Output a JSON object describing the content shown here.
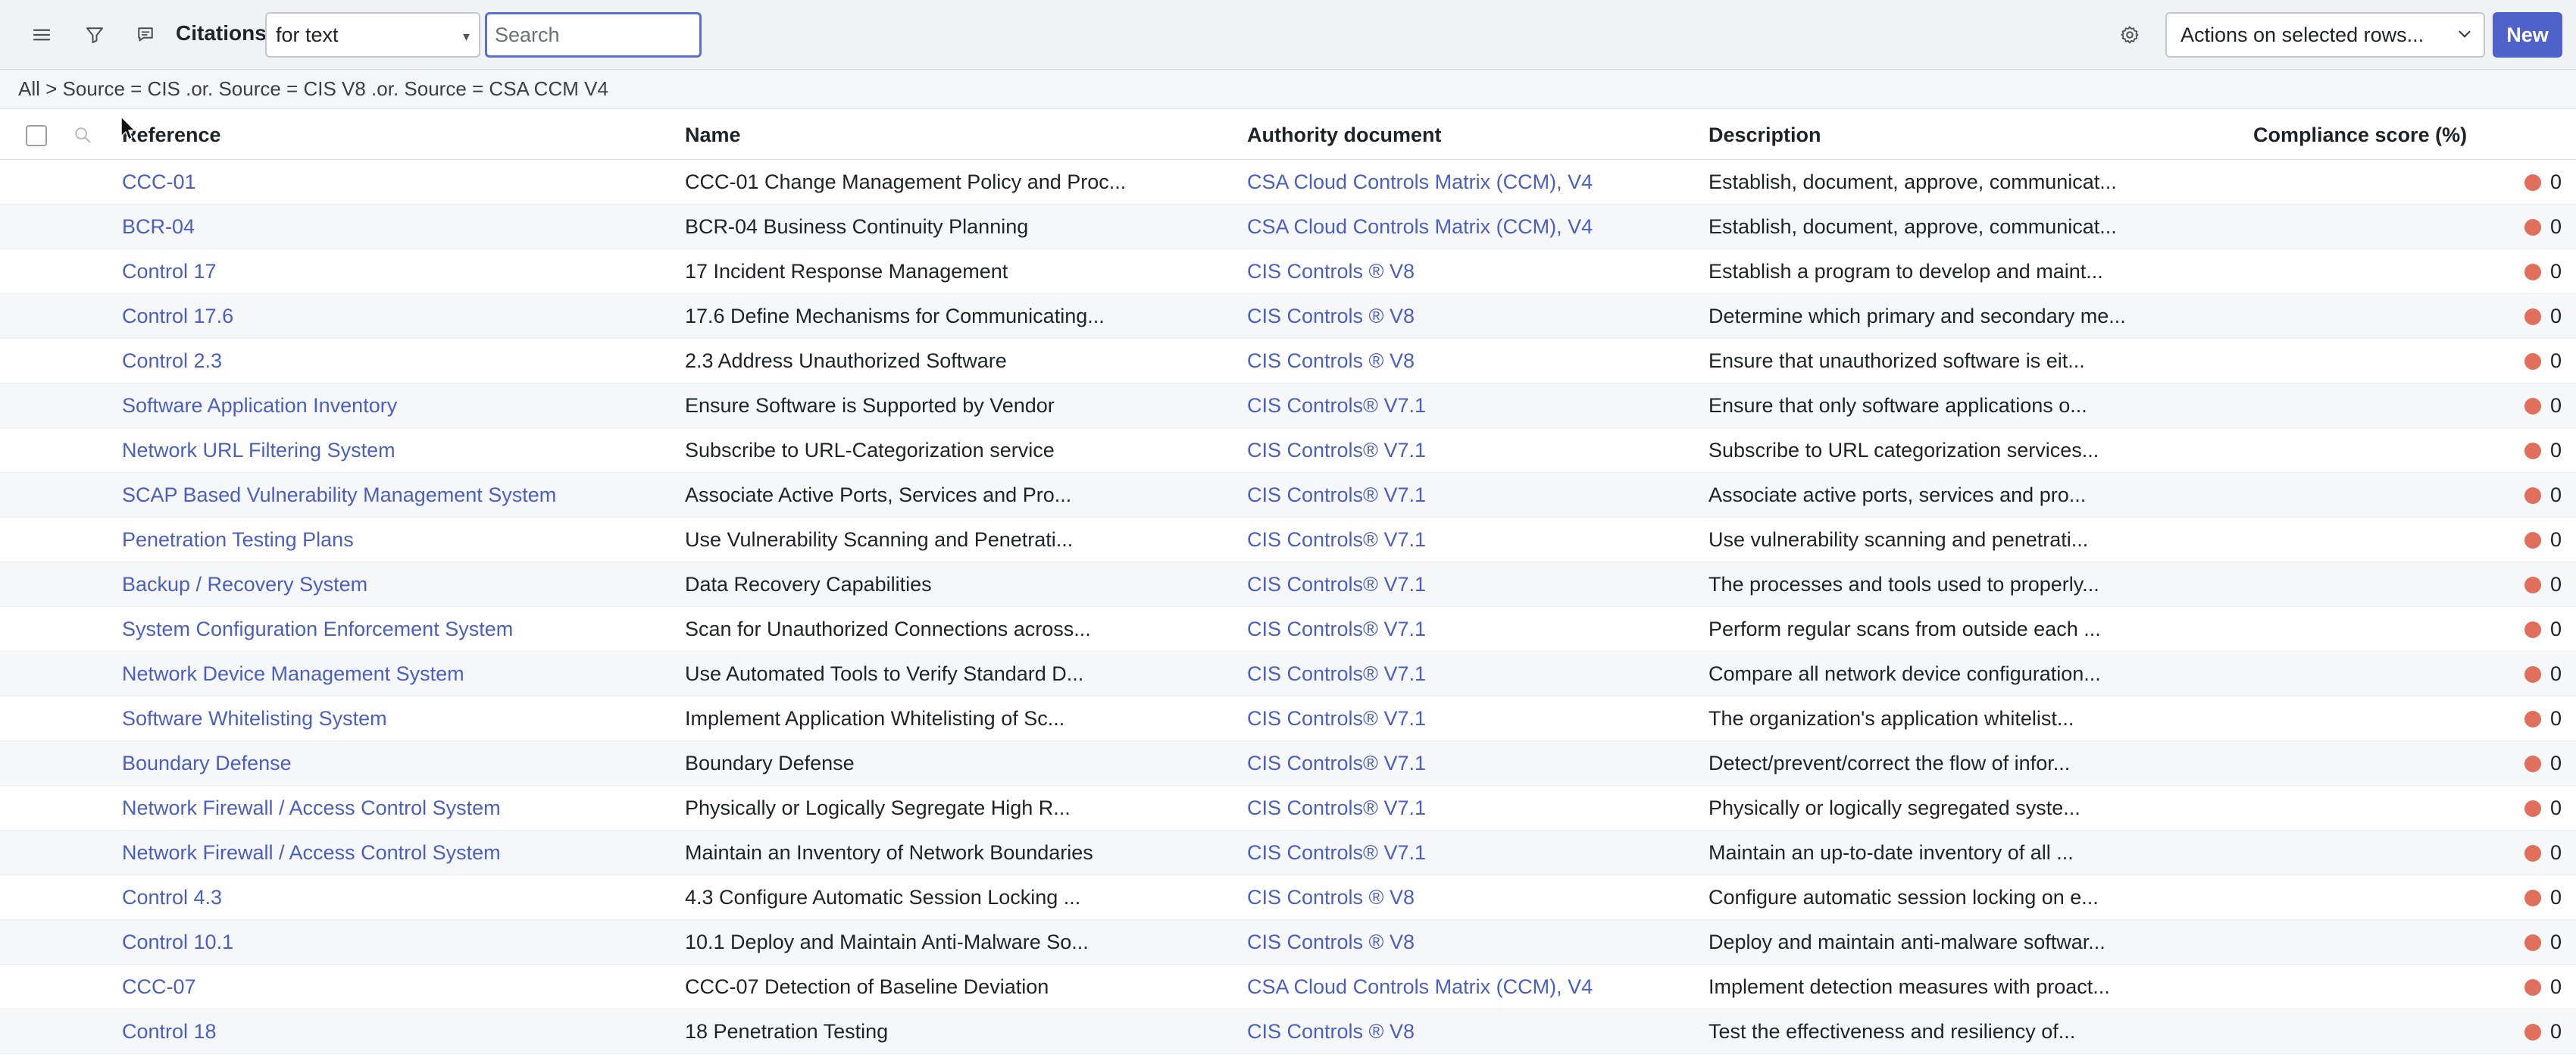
{
  "header": {
    "title": "Citations",
    "search_type": "for text",
    "search_placeholder": "Search",
    "actions_label": "Actions on selected rows...",
    "new_label": "New",
    "accent_color": "#4f62c9"
  },
  "breadcrumb": "All > Source = CIS .or. Source = CIS V8 .or. Source = CSA CCM V4",
  "columns": {
    "reference": "Reference",
    "name": "Name",
    "authority": "Authority document",
    "description": "Description",
    "score": "Compliance score (%)"
  },
  "rows": [
    {
      "ref": "CCC-01",
      "name": "CCC-01 Change Management Policy and Proc...",
      "authority": "CSA Cloud Controls Matrix (CCM), V4",
      "description": "Establish, document, approve, communicat...",
      "score": "0"
    },
    {
      "ref": "BCR-04",
      "name": "BCR-04 Business Continuity Planning",
      "authority": "CSA Cloud Controls Matrix (CCM), V4",
      "description": "Establish, document, approve, communicat...",
      "score": "0"
    },
    {
      "ref": "Control 17",
      "name": "17 Incident Response Management",
      "authority": "CIS Controls ® V8",
      "description": "Establish a program to develop and maint...",
      "score": "0"
    },
    {
      "ref": "Control 17.6",
      "name": "17.6 Define Mechanisms for Communicating...",
      "authority": "CIS Controls ® V8",
      "description": "Determine which primary and secondary me...",
      "score": "0"
    },
    {
      "ref": "Control 2.3",
      "name": "2.3 Address Unauthorized Software",
      "authority": "CIS Controls ® V8",
      "description": "Ensure that unauthorized software is eit...",
      "score": "0"
    },
    {
      "ref": "Software Application Inventory",
      "name": "Ensure Software is Supported by Vendor",
      "authority": "CIS Controls® V7.1",
      "description": "Ensure that only software applications o...",
      "score": "0"
    },
    {
      "ref": "Network URL Filtering System",
      "name": "Subscribe to URL-Categorization service",
      "authority": "CIS Controls® V7.1",
      "description": "Subscribe to URL categorization services...",
      "score": "0"
    },
    {
      "ref": "SCAP Based Vulnerability Management System",
      "name": "Associate Active Ports, Services and Pro...",
      "authority": "CIS Controls® V7.1",
      "description": "Associate active ports, services and pro...",
      "score": "0"
    },
    {
      "ref": "Penetration Testing Plans",
      "name": "Use Vulnerability Scanning and Penetrati...",
      "authority": "CIS Controls® V7.1",
      "description": "Use vulnerability scanning and penetrati...",
      "score": "0"
    },
    {
      "ref": "Backup / Recovery System",
      "name": "Data Recovery Capabilities",
      "authority": "CIS Controls® V7.1",
      "description": "The processes and tools used to properly...",
      "score": "0"
    },
    {
      "ref": "System Configuration Enforcement System",
      "name": "Scan for Unauthorized Connections across...",
      "authority": "CIS Controls® V7.1",
      "description": "Perform regular scans from outside each ...",
      "score": "0"
    },
    {
      "ref": "Network Device Management System",
      "name": "Use Automated Tools to Verify Standard D...",
      "authority": "CIS Controls® V7.1",
      "description": "Compare all network device configuration...",
      "score": "0"
    },
    {
      "ref": "Software Whitelisting System",
      "name": "Implement Application Whitelisting of Sc...",
      "authority": "CIS Controls® V7.1",
      "description": "The organization's application whitelist...",
      "score": "0"
    },
    {
      "ref": "Boundary Defense",
      "name": "Boundary Defense",
      "authority": "CIS Controls® V7.1",
      "description": "Detect/prevent/correct the flow of infor...",
      "score": "0"
    },
    {
      "ref": "Network Firewall / Access Control System",
      "name": "Physically or Logically Segregate High R...",
      "authority": "CIS Controls® V7.1",
      "description": "Physically or logically segregated syste...",
      "score": "0"
    },
    {
      "ref": "Network Firewall / Access Control System",
      "name": "Maintain an Inventory of Network Boundaries",
      "authority": "CIS Controls® V7.1",
      "description": "Maintain an up-to-date inventory of all ...",
      "score": "0"
    },
    {
      "ref": "Control 4.3",
      "name": "4.3 Configure Automatic Session Locking ...",
      "authority": "CIS Controls ® V8",
      "description": "Configure automatic session locking on e...",
      "score": "0"
    },
    {
      "ref": "Control 10.1",
      "name": "10.1 Deploy and Maintain Anti-Malware So...",
      "authority": "CIS Controls ® V8",
      "description": "Deploy and maintain anti-malware softwar...",
      "score": "0"
    },
    {
      "ref": "CCC-07",
      "name": "CCC-07 Detection of Baseline Deviation",
      "authority": "CSA Cloud Controls Matrix (CCM), V4",
      "description": "Implement detection measures with proact...",
      "score": "0"
    },
    {
      "ref": "Control 18",
      "name": "18 Penetration Testing",
      "authority": "CIS Controls ® V8",
      "description": "Test the effectiveness and resiliency of...",
      "score": "0"
    }
  ],
  "icons": [
    "hamburger-menu-icon",
    "filter-icon",
    "comment-icon",
    "gear-icon",
    "chevron-down-icon",
    "search-icon",
    "status-dot-icon"
  ],
  "score_dot_color": "#e0705c"
}
